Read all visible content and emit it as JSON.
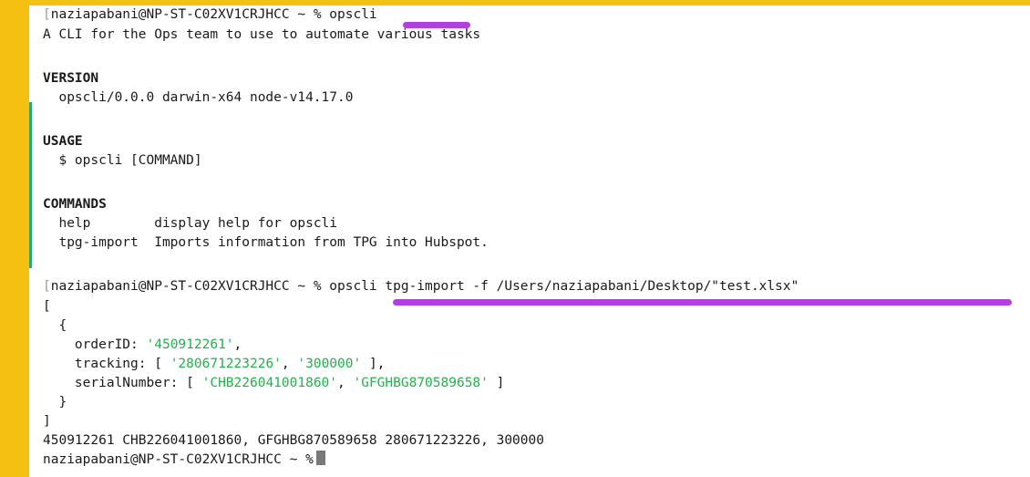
{
  "colors": {
    "frame": "#f6c012",
    "highlight_underline": "#b23fe0",
    "string": "#22b14c",
    "mark_bar": "#2aa876"
  },
  "terminal": {
    "prompt": "naziapabani@NP-ST-C02XV1CRJHCC ~ %",
    "cmd1": "opscli",
    "description": "A CLI for the Ops team to use to automate various tasks",
    "version_header": "VERSION",
    "version_text": "  opscli/0.0.0 darwin-x64 node-v14.17.0",
    "usage_header": "USAGE",
    "usage_text": "  $ opscli [COMMAND]",
    "commands_header": "COMMANDS",
    "commands": [
      {
        "name": "  help        ",
        "desc": "display help for opscli"
      },
      {
        "name": "  tpg-import  ",
        "desc": "Imports information from TPG into Hubspot."
      }
    ],
    "cmd2": "opscli tpg-import -f /Users/naziapabani/Desktop/\"test.xlsx\"",
    "json_open": "[",
    "obj_open": "  {",
    "order_key": "    orderID: ",
    "order_val": "'450912261'",
    "order_tail": ",",
    "tracking_key": "    tracking: [ ",
    "tracking_vals": [
      "'280671223226'",
      "'300000'"
    ],
    "tracking_tail": " ],",
    "serial_key": "    serialNumber: [ ",
    "serial_vals": [
      "'CHB226041001860'",
      "'GFGHBG870589658'"
    ],
    "serial_tail": " ]",
    "obj_close": "  }",
    "json_close": "]",
    "result_line": "450912261 CHB226041001860, GFGHBG870589658 280671223226, 300000"
  }
}
